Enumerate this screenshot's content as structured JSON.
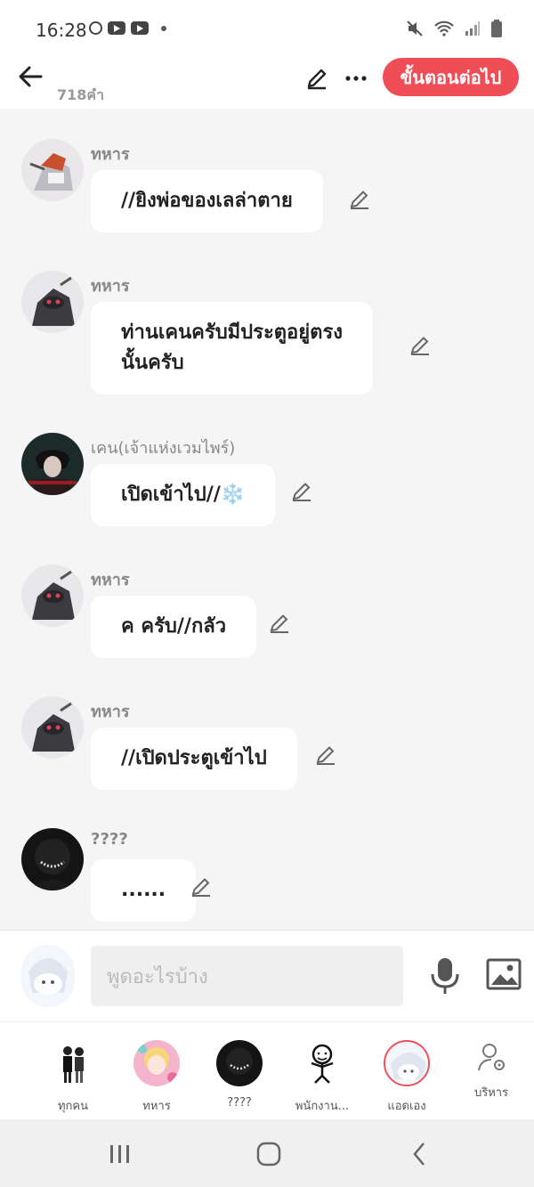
{
  "status_bar": {
    "time": "16:28"
  },
  "header": {
    "word_count": "718คำ",
    "next_button": "ขั้นตอนต่อไป"
  },
  "messages": [
    {
      "sender": "ทหาร",
      "text": "//ยิงพ่อของเลล่าตาย"
    },
    {
      "sender": "ทหาร",
      "text": "ท่านเคนครับมีประตูอยู่ตรง\nนั้นครับ"
    },
    {
      "sender": "เคน(เจ้าแห่งเวมไพร์)",
      "text": "เปิดเข้าไป//❄️"
    },
    {
      "sender": "ทหาร",
      "text": "ค ครับ//กลัว"
    },
    {
      "sender": "ทหาร",
      "text": "//เปิดประตูเข้าไป"
    },
    {
      "sender": "????",
      "text": "......"
    }
  ],
  "input": {
    "placeholder": "พูดอะไรบ้าง"
  },
  "characters": [
    {
      "label": "ทุกคน"
    },
    {
      "label": "ทหาร"
    },
    {
      "label": "????"
    },
    {
      "label": "พนักงาน..."
    },
    {
      "label": "แอดเอง"
    },
    {
      "label": "บริหาร"
    }
  ],
  "colors": {
    "accent": "#f04e57",
    "background": "#f5f5f5",
    "bubble": "#ffffff"
  }
}
